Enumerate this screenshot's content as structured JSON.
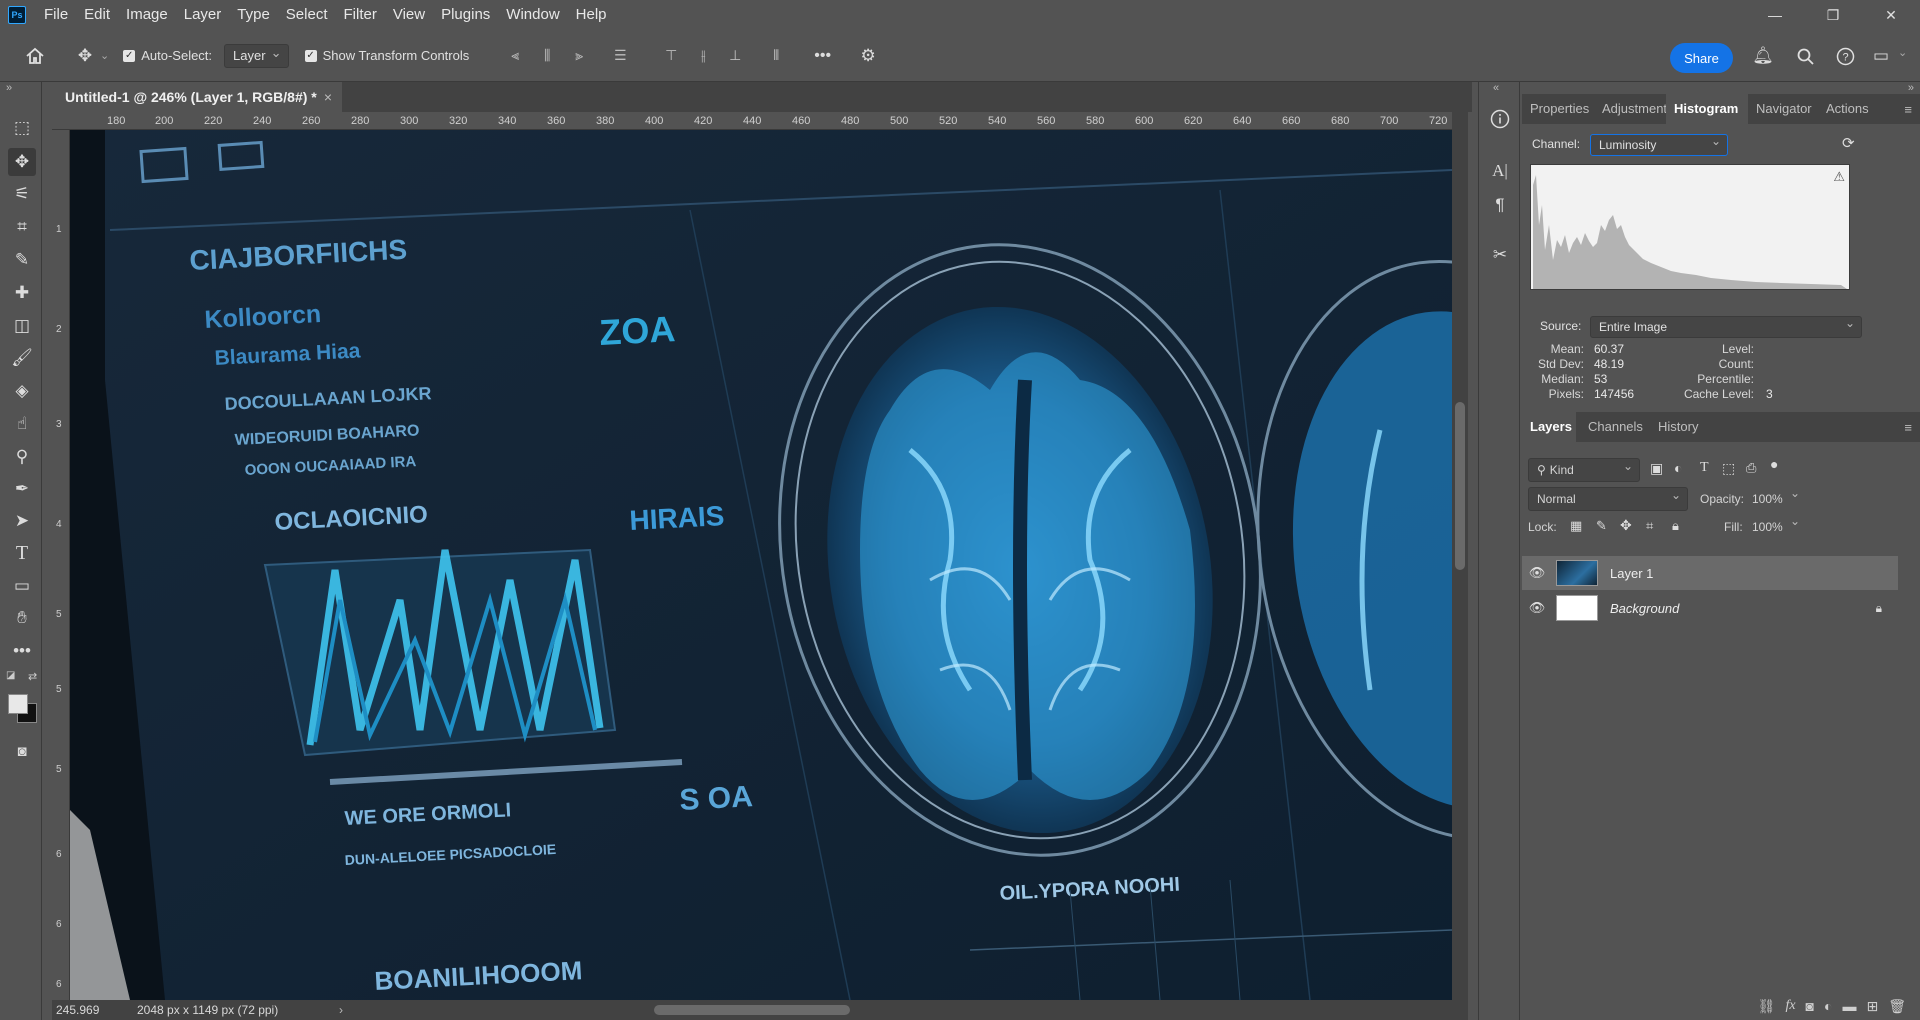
{
  "app": {
    "logo": "Ps",
    "menu": [
      "File",
      "Edit",
      "Image",
      "Layer",
      "Type",
      "Select",
      "Filter",
      "View",
      "Plugins",
      "Window",
      "Help"
    ],
    "window_controls": [
      "—",
      "❐",
      "✕"
    ]
  },
  "options_bar": {
    "auto_select_label": "Auto-Select:",
    "auto_select_checked": true,
    "auto_select_target": "Layer",
    "show_transform_label": "Show Transform Controls",
    "show_transform_checked": true,
    "more_label": "•••",
    "share_label": "Share"
  },
  "document": {
    "tab_title": "Untitled-1 @ 246% (Layer 1, RGB/8#) *",
    "tab_close": "×"
  },
  "ruler": {
    "h_ticks": [
      "180",
      "200",
      "220",
      "240",
      "260",
      "280",
      "300",
      "320",
      "340",
      "360",
      "380",
      "400",
      "420",
      "440",
      "460",
      "480",
      "500",
      "520",
      "540",
      "560",
      "580",
      "600",
      "620",
      "640",
      "660",
      "680",
      "700",
      "720"
    ],
    "v_ticks": [
      "1",
      "2",
      "3",
      "4",
      "5",
      "5",
      "5",
      "6",
      "6",
      "6"
    ]
  },
  "canvas": {
    "texts": [
      "CIAJBORFIICHS",
      "Kolloorcn",
      "Blaurama Hiaa",
      "DOCOULLAAAN LOJKR",
      "WIDEORUIDI BOAHARO",
      "OOON OUCAAIAAD IRA",
      "OCLAOICNIO",
      "HIRAIS",
      "ZOA",
      "WE ORE ORMOLI",
      "DUN-ALELOEE PICSADOCLOIE",
      "S OA",
      "OIL.YPORA NOOHI",
      "BOANILIHOOOM"
    ]
  },
  "status": {
    "zoom": "245.969",
    "doc_info": "2048 px x 1149 px (72 ppi)",
    "arrow": "›"
  },
  "panels": {
    "top_tabs": [
      "Properties",
      "Adjustments",
      "Histogram",
      "Navigator",
      "Actions"
    ],
    "active_top_tab": "Histogram",
    "histogram": {
      "channel_label": "Channel:",
      "channel_value": "Luminosity",
      "source_label": "Source:",
      "source_value": "Entire Image",
      "stats_left": [
        {
          "label": "Mean:",
          "value": "60.37"
        },
        {
          "label": "Std Dev:",
          "value": "48.19"
        },
        {
          "label": "Median:",
          "value": "53"
        },
        {
          "label": "Pixels:",
          "value": "147456"
        }
      ],
      "stats_right": [
        {
          "label": "Level:",
          "value": ""
        },
        {
          "label": "Count:",
          "value": ""
        },
        {
          "label": "Percentile:",
          "value": ""
        },
        {
          "label": "Cache Level:",
          "value": "3"
        }
      ],
      "warning_icon": "⚠"
    },
    "layers_tabs": [
      "Layers",
      "Channels",
      "History"
    ],
    "active_layers_tab": "Layers",
    "layers": {
      "filter_kind": "Kind",
      "blend_mode": "Normal",
      "opacity_label": "Opacity:",
      "opacity_value": "100%",
      "lock_label": "Lock:",
      "fill_label": "Fill:",
      "fill_value": "100%",
      "items": [
        {
          "name": "Layer 1",
          "visible": true,
          "selected": true,
          "locked": false
        },
        {
          "name": "Background",
          "visible": true,
          "selected": false,
          "locked": true
        }
      ]
    }
  },
  "colors": {
    "accent": "#1473e6",
    "ui_bg": "#535353",
    "canvas_glow": "#3fb6ff"
  }
}
